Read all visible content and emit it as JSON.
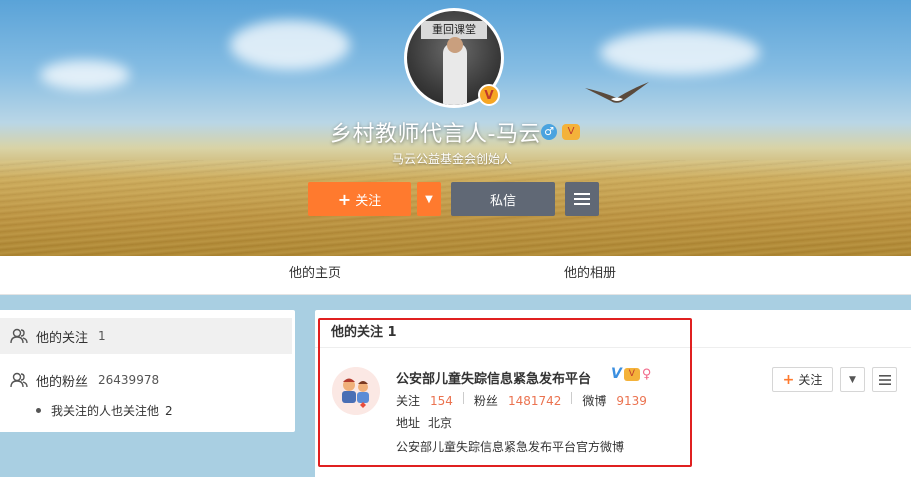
{
  "profile": {
    "name": "乡村教师代言人-马云",
    "description": "马云公益基金会创始人",
    "avatar_sign": "重回课堂",
    "verified": true,
    "gender_icon": "male-icon",
    "level_icon": "vip-level-icon"
  },
  "actions": {
    "follow_label": "关注",
    "message_label": "私信"
  },
  "nav": {
    "tabs": [
      {
        "label": "他的主页"
      },
      {
        "label": "他的相册"
      }
    ]
  },
  "sidebar": {
    "following_label": "他的关注",
    "following_count": "1",
    "fans_label": "他的粉丝",
    "fans_count": "26439978",
    "mutual_label": "我关注的人也关注他",
    "mutual_count": "2"
  },
  "main": {
    "title": "他的关注 1",
    "users": [
      {
        "name": "公安部儿童失踪信息紧急发布平台",
        "stats": {
          "following_label": "关注",
          "following": "154",
          "fans_label": "粉丝",
          "fans": "1481742",
          "weibo_label": "微博",
          "weibo": "9139"
        },
        "address_label": "地址",
        "address": "北京",
        "bio": "公安部儿童失踪信息紧急发布平台官方微博",
        "follow_label": "关注"
      }
    ]
  },
  "colors": {
    "accent": "#ff7a2e",
    "secondary_button": "#606875",
    "stat_value": "#eb7350",
    "highlight_border": "#e02020"
  }
}
